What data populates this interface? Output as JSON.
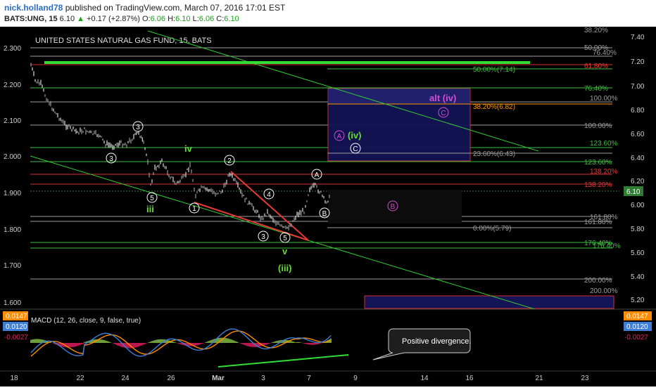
{
  "header": {
    "user": "nick.holland78",
    "published_text": "published on TradingView.com, March 07, 2016 17:01 EST",
    "symbol": "BATS:UNG, 15",
    "last": "6.10",
    "change": "+0.17 (+2.87%)",
    "o_label": "O:",
    "o_val": "6.06",
    "h_label": "H:",
    "h_val": "6.10",
    "l_label": "L:",
    "l_val": "6.06",
    "c_label": "C:",
    "c_val": "6.10"
  },
  "colors": {
    "up": "#1ba31b",
    "fib_green": "#3fbf3f",
    "fib_red": "#d32f2f",
    "fib_gray": "#9e9e9e",
    "trend_green": "#33cc33",
    "wedge_red": "#e53935",
    "box_blue": "#1a1a5c",
    "label_green": "#66dd33",
    "label_magenta": "#d54cd5",
    "macd_line": "#3d7fd6",
    "signal_line": "#ff8c00",
    "hist_neg": "#e91e63",
    "hist_pos": "#8bc34a"
  },
  "chart_data": {
    "type": "candlestick",
    "title": "UNITED STATES NATURAL GAS FUND, 15, BATS",
    "left_axis_ticks": [
      "2.300",
      "2.200",
      "2.100",
      "2.000",
      "1.900",
      "1.800",
      "1.700",
      "1.600"
    ],
    "right_axis_ticks": [
      "7.40",
      "7.20",
      "7.00",
      "6.80",
      "6.60",
      "6.40",
      "6.20",
      "6.00",
      "5.80",
      "5.60",
      "5.40",
      "5.20"
    ],
    "right_axis_range": [
      5.1,
      7.5
    ],
    "last_price_tag": "6.10",
    "x_ticks": [
      "18",
      "22",
      "24",
      "26",
      "Mar",
      "3",
      "7",
      "9",
      "14",
      "16",
      "21",
      "23"
    ],
    "fib_levels": [
      {
        "label": "38.20%",
        "color": "gray"
      },
      {
        "label": "50.00%",
        "color": "gray"
      },
      {
        "label": "76.40%",
        "color": "gray"
      },
      {
        "label": "61.80%",
        "color": "red"
      },
      {
        "label": "50.00%(7.14)",
        "color": "green"
      },
      {
        "label": "76.40%",
        "color": "green"
      },
      {
        "label": "100.00%",
        "color": "gray"
      },
      {
        "label": "38.20%(6.82)",
        "color": "orange"
      },
      {
        "label": "100.00%",
        "color": "gray"
      },
      {
        "label": "123.60%",
        "color": "green"
      },
      {
        "label": "23.60%(6.43)",
        "color": "gray"
      },
      {
        "label": "123.60%",
        "color": "green"
      },
      {
        "label": "138.20%",
        "color": "red"
      },
      {
        "label": "138.20%",
        "color": "red"
      },
      {
        "label": "161.80%",
        "color": "gray"
      },
      {
        "label": "161.80%",
        "color": "gray"
      },
      {
        "label": "0.00%(5.79)",
        "color": "gray"
      },
      {
        "label": "176.40%",
        "color": "green"
      },
      {
        "label": "176.40%",
        "color": "green"
      },
      {
        "label": "200.00%",
        "color": "gray"
      },
      {
        "label": "200.00%",
        "color": "gray"
      }
    ],
    "wave_labels": {
      "iv": "iv",
      "iii": "iii",
      "v": "v",
      "wave_iii": "(iii)",
      "wave_iv": "(iv)",
      "alt_iv": "alt (iv)",
      "c3a": "3",
      "c4a": "4",
      "c3b": "3",
      "c5a": "5",
      "c1": "1",
      "c2": "2",
      "c4b": "4",
      "c5b": "5",
      "cA": "A",
      "cB": "B",
      "cA_box": "A",
      "cC_box": "C",
      "cC_alt": "C",
      "cB_mag": "B"
    },
    "macd": {
      "label": "MACD (12, 26, close, 9, false, true)",
      "values_right": [
        "0.0147",
        "0.0120",
        "-0.0027"
      ],
      "values_left": [
        "0.0147",
        "0.0120",
        "-0.0027"
      ]
    },
    "annotation": "Positive divergence.",
    "grid": false
  }
}
